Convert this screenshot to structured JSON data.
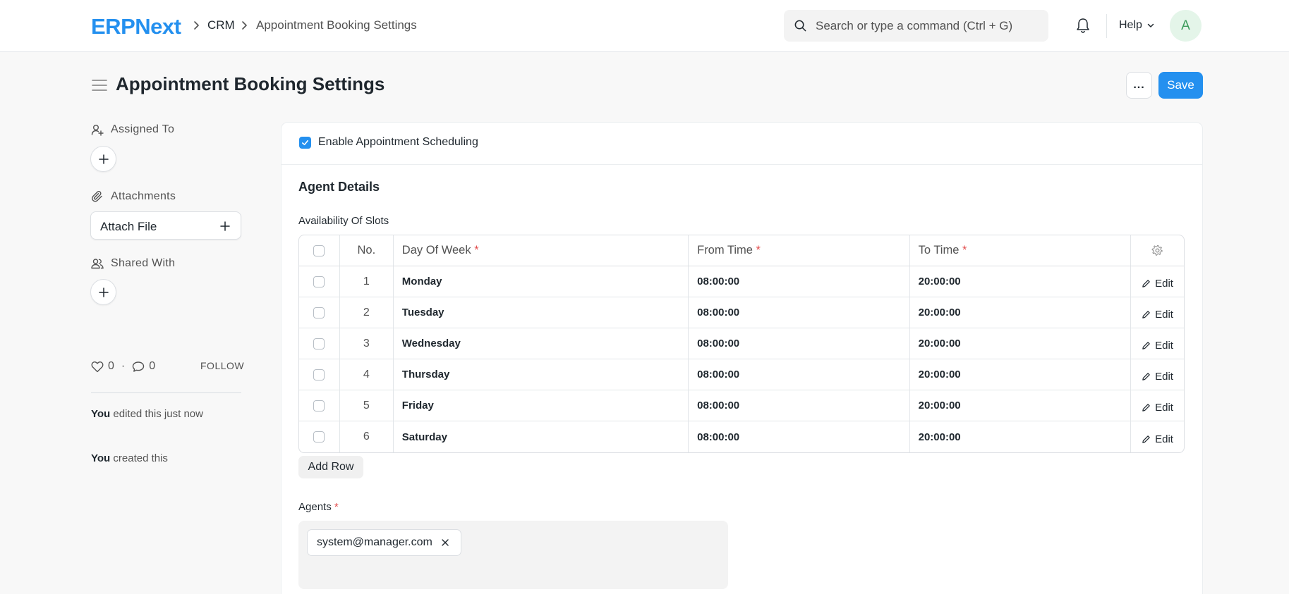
{
  "navbar": {
    "logo_text": "ERPNext",
    "breadcrumb": [
      "CRM",
      "Appointment Booking Settings"
    ],
    "search_placeholder": "Search or type a command (Ctrl + G)",
    "help_label": "Help",
    "avatar_initial": "A"
  },
  "page": {
    "title": "Appointment Booking Settings",
    "more_label": "...",
    "save_label": "Save"
  },
  "sidebar": {
    "assigned_to_label": "Assigned To",
    "attachments_label": "Attachments",
    "attach_file_label": "Attach File",
    "shared_with_label": "Shared With",
    "likes_count": "0",
    "separator": "·",
    "comments_count": "0",
    "follow_label": "FOLLOW",
    "activity": [
      {
        "actor": "You",
        "text": "edited this just now"
      },
      {
        "actor": "You",
        "text": "created this"
      }
    ]
  },
  "form": {
    "enable_label": "Enable Appointment Scheduling",
    "enable_checked": true,
    "section_title": "Agent Details",
    "slots_label": "Availability Of Slots",
    "columns": {
      "no": "No.",
      "day": "Day Of Week",
      "from": "From Time",
      "to": "To Time"
    },
    "required_mark": "*",
    "rows": [
      {
        "no": "1",
        "day": "Monday",
        "from": "08:00:00",
        "to": "20:00:00",
        "edit": "Edit"
      },
      {
        "no": "2",
        "day": "Tuesday",
        "from": "08:00:00",
        "to": "20:00:00",
        "edit": "Edit"
      },
      {
        "no": "3",
        "day": "Wednesday",
        "from": "08:00:00",
        "to": "20:00:00",
        "edit": "Edit"
      },
      {
        "no": "4",
        "day": "Thursday",
        "from": "08:00:00",
        "to": "20:00:00",
        "edit": "Edit"
      },
      {
        "no": "5",
        "day": "Friday",
        "from": "08:00:00",
        "to": "20:00:00",
        "edit": "Edit"
      },
      {
        "no": "6",
        "day": "Saturday",
        "from": "08:00:00",
        "to": "20:00:00",
        "edit": "Edit"
      }
    ],
    "add_row_label": "Add Row",
    "agents_label": "Agents",
    "agents": [
      "system@manager.com"
    ]
  },
  "colors": {
    "primary": "#2490ef",
    "required": "#e24c4c",
    "avatar_bg": "#e4f5e9",
    "avatar_fg": "#3c9c5c"
  }
}
